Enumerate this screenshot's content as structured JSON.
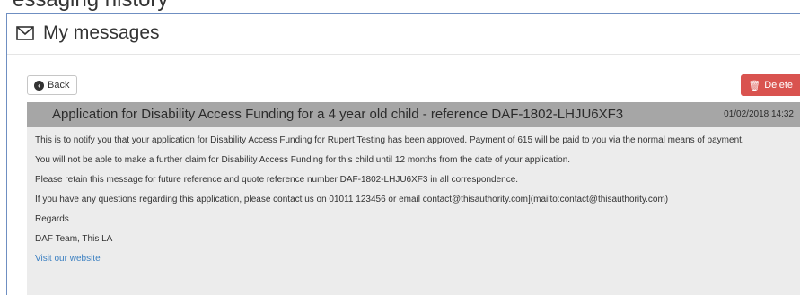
{
  "page": {
    "cutoff_heading": "essaging history"
  },
  "panel": {
    "title": "My messages",
    "icon": "envelope-icon"
  },
  "toolbar": {
    "back_label": "Back",
    "back_icon": "chevron-circle-left-icon",
    "delete_label": "Delete",
    "delete_icon": "trash-icon",
    "delete_color": "#d9534f"
  },
  "message": {
    "subject": "Application for Disability Access Funding for a 4 year old child - reference DAF-1802-LHJU6XF3",
    "date": "01/02/2018 14:32",
    "lines": [
      "This is to notify you that your application for Disability Access Funding for Rupert Testing has been approved. Payment of 615 will be paid to you via the normal means of payment.",
      "You will not be able to make a further claim for Disability Access Funding for this child until 12 months from the date of your application.",
      "Please retain this message for future reference and quote reference number DAF-1802-LHJU6XF3 in all correspondence.",
      "If you have any questions regarding this application, please contact us on 01011 123456 or email contact@thisauthority.com](mailto:contact@thisauthority.com)",
      "Regards",
      "DAF Team, This LA"
    ],
    "link_text": "Visit our website"
  },
  "colors": {
    "header_bar": "#a6a6a6",
    "body_bg": "#ececec",
    "link": "#3a7fc1",
    "panel_border": "#6f8fc2"
  }
}
